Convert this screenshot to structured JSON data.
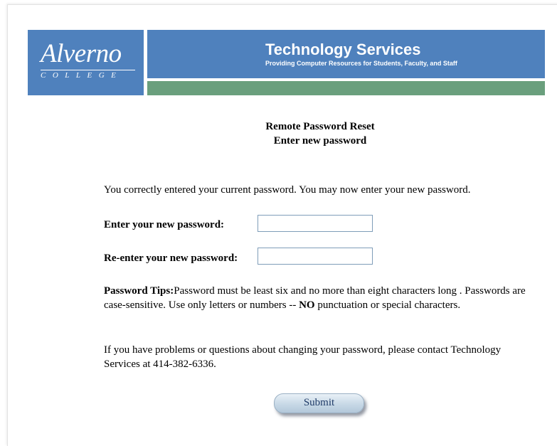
{
  "header": {
    "logo_word": "Alverno",
    "logo_sub": "COLLEGE",
    "title": "Technology Services",
    "subtitle": "Providing Computer Resources for Students, Faculty, and Staff",
    "colors": {
      "blue": "#4f81bd",
      "green": "#6a9f7d"
    }
  },
  "page": {
    "heading_line1": "Remote Password Reset",
    "heading_line2": "Enter new password",
    "intro": "You correctly entered your current password. You may now enter your new password."
  },
  "form": {
    "new_password_label": "Enter your new password:",
    "new_password_value": "",
    "reenter_password_label": "Re-enter your new password:",
    "reenter_password_value": "",
    "submit_label": "Submit"
  },
  "tips": {
    "title": "Password Tips:",
    "text1": "Password must be least six and no more than eight characters long . Passwords are case-sensitive. Use only letters or numbers -- ",
    "emphasis": "NO",
    "text2": " punctuation or special characters."
  },
  "contact": {
    "text": "If you have problems or questions about changing your password, please contact Technology Services at 414-382-6336."
  }
}
